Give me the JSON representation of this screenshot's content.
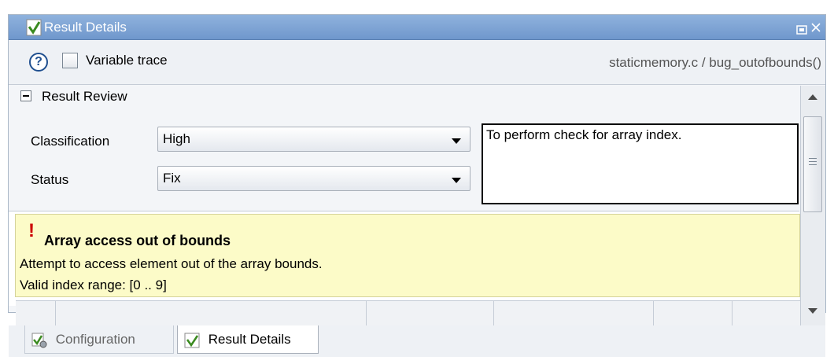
{
  "window": {
    "title": "Result Details"
  },
  "toolbar": {
    "help_label": "?",
    "variable_trace_label": "Variable trace",
    "location": "staticmemory.c / bug_outofbounds()"
  },
  "review": {
    "section_label": "Result Review",
    "classification_label": "Classification",
    "classification_value": "High",
    "status_label": "Status",
    "status_value": "Fix",
    "comment": "To perform check for array index."
  },
  "alert": {
    "icon": "!",
    "title": "Array access out of bounds",
    "line1": "Attempt to access element out of the array bounds.",
    "line2": "Valid index range: [0 .. 9]"
  },
  "tabs": [
    {
      "label": "Configuration"
    },
    {
      "label": "Result Details"
    }
  ],
  "colors": {
    "title_bar": "#7fa4d4",
    "alert_bg": "#fcfbc8",
    "alert_icon": "#cc0000",
    "check_icon": "#3a8a1f"
  }
}
